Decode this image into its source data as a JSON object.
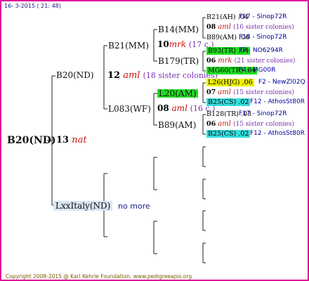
{
  "header": {
    "date": "16-  3-2015 ( 21: 48)"
  },
  "footer": {
    "copyright": "Copyright 2008-2015 @ Karl Kehrle Foundation.   www.pedigreeapis.org"
  },
  "colors": {
    "frame": "#e0149a",
    "green": "#22dd22",
    "cyan": "#33dddd",
    "yellow": "#f0f000",
    "lines": "#222222"
  },
  "root": {
    "name": "B20(ND)",
    "num": "13",
    "race": "nat"
  },
  "gen1": {
    "mother": {
      "name": "B20(ND)",
      "num": "12",
      "race": "aml",
      "sisters": "(18 sister colonies)"
    },
    "father": {
      "name": "LxxItaly(ND)",
      "note": "no more"
    }
  },
  "gen2": {
    "a": {
      "name": "B21(MM)"
    },
    "b": {
      "name": "L083(WF)",
      "num": "08",
      "race": "aml",
      "sisters": "(16 c.)"
    }
  },
  "gen3": {
    "a": {
      "name": "B14(MM)",
      "num": "10",
      "race": "mrk",
      "sisters": "(17 c.)"
    },
    "b": {
      "name": "B179(TR)"
    },
    "c": {
      "name": "L20(AM)"
    },
    "d": {
      "name": "B89(AM)"
    }
  },
  "gen4": [
    {
      "name": "B21(AH)",
      "val": ".04",
      "breeder": "F17 - Sinop72R"
    },
    {
      "num": "08",
      "race": "aml",
      "sisters": "(16 sister colonies)"
    },
    {
      "name": "B89(AM)",
      "val": ".06",
      "breeder": "F18 - Sinop72R"
    },
    {
      "name": "B93(TR)",
      "val": ".04",
      "breeder": "F7 - NO6294R"
    },
    {
      "num": "06",
      "race": "mrk",
      "sisters": "(21 sister colonies)"
    },
    {
      "name": "MG60(TR)",
      "val": ".04",
      "breeder": "F4 - MG00R"
    },
    {
      "name": "L26(HJG)",
      "val": ".06",
      "breeder": "F2 - NewZl02Q"
    },
    {
      "num": "07",
      "race": "aml",
      "sisters": "(15 sister colonies)"
    },
    {
      "name": "B25(CS)",
      "val": ".02",
      "breeder": "F12 - AthosSt80R"
    },
    {
      "name": "B128(TR)",
      "val": ".03",
      "breeder": "F17 - Sinop72R"
    },
    {
      "num": "06",
      "race": "aml",
      "sisters": "(15 sister colonies)"
    },
    {
      "name": "B25(CS)",
      "val": ".02",
      "breeder": "F12 - AthosSt80R"
    }
  ]
}
